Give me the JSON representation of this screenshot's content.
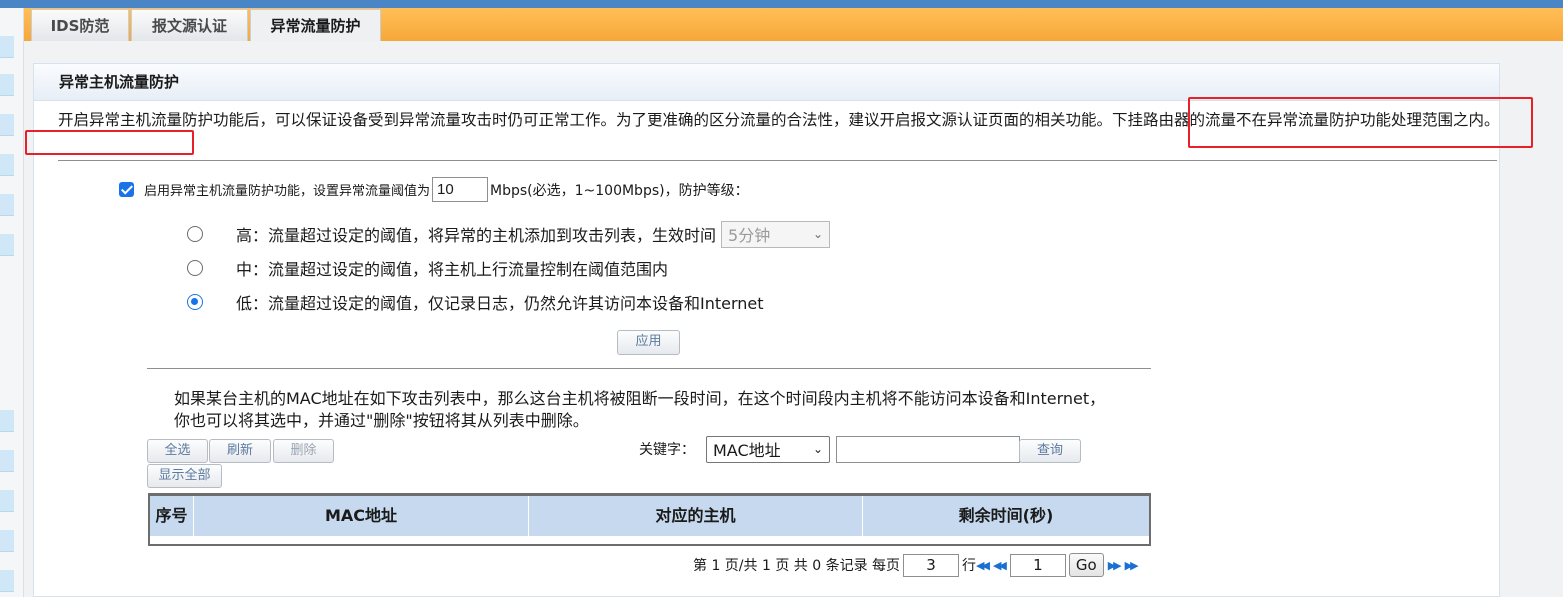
{
  "tabs": [
    "IDS防范",
    "报文源认证",
    "异常流量防护"
  ],
  "panel": {
    "title": "异常主机流量防护",
    "description": "开启异常主机流量防护功能后，可以保证设备受到异常流量攻击时仍可正常工作。为了更准确的区分流量的合法性，建议开启报文源认证页面的相关功能。下挂路由器的流量不在异常流量防护功能处理范围之内。"
  },
  "enable": {
    "checked": true,
    "label": "启用异常主机流量防护功能，设置异常流量阈值为",
    "threshold": "10",
    "suffix": "Mbps(必选，1~100Mbps)，防护等级："
  },
  "levels": [
    {
      "label": "高：流量超过设定的阈值，将异常的主机添加到攻击列表，生效时间",
      "selected": false
    },
    {
      "label": "中：流量超过设定的阈值，将主机上行流量控制在阈值范围内",
      "selected": false
    },
    {
      "label": "低：流量超过设定的阈值，仅记录日志，仍然允许其访问本设备和Internet",
      "selected": true
    }
  ],
  "effect_time": "5分钟",
  "apply_button": "应用",
  "attack_list": {
    "info_line1": "如果某台主机的MAC地址在如下攻击列表中，那么这台主机将被阻断一段时间，在这个时间段内主机将不能访问本设备和Internet，",
    "info_line2": "你也可以将其选中，并通过\"删除\"按钮将其从列表中删除。",
    "buttons": {
      "select_all": "全选",
      "refresh": "刷新",
      "delete": "删除",
      "show_all": "显示全部",
      "search": "查询"
    },
    "keyword_label": "关键字：",
    "keyword_type": "MAC地址",
    "keyword_value": "",
    "columns": [
      "序号",
      "MAC地址",
      "对应的主机",
      "剩余时间(秒)"
    ],
    "rows": []
  },
  "pager": {
    "status": "第 1 页/共 1 页 共 0 条记录 每页",
    "per_page": "3",
    "rows_label": "行",
    "page_input": "1",
    "go": "Go"
  },
  "colors": {
    "tab_bar": "#f7a73a",
    "top_strip": "#4a86c5",
    "table_header": "#c6d9ee",
    "accent": "#1a73e8",
    "highlight_box": "#e8202a"
  }
}
